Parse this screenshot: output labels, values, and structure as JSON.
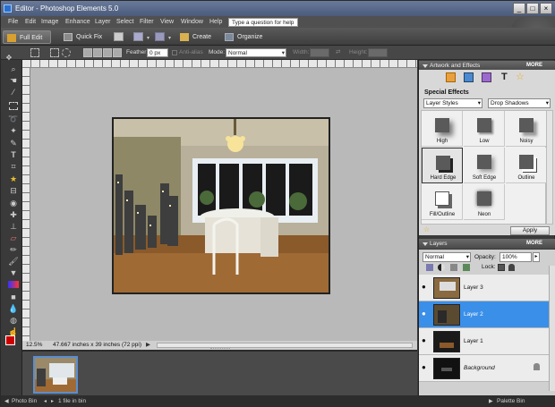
{
  "window": {
    "title": "Editor - Photoshop Elements 5.0"
  },
  "menu": {
    "items": [
      "File",
      "Edit",
      "Image",
      "Enhance",
      "Layer",
      "Select",
      "Filter",
      "View",
      "Window",
      "Help"
    ],
    "help_placeholder": "Type a question for help"
  },
  "modebar": {
    "full_edit": "Full Edit",
    "quick_fix": "Quick Fix",
    "create": "Create",
    "organize": "Organize"
  },
  "options": {
    "feather_label": "Feather:",
    "feather_value": "0 px",
    "anti_alias": "Anti-alias",
    "mode_label": "Mode:",
    "mode_value": "Normal",
    "width_label": "Width:",
    "height_label": "Height:"
  },
  "status": {
    "zoom": "12.5%",
    "doc_size": "47.667 inches x 39 inches (72 ppi)"
  },
  "bottom": {
    "photo_bin": "Photo Bin",
    "file_count": "1 file in bin",
    "palette_bin": "Palette Bin"
  },
  "artwork": {
    "title": "Artwork and Effects",
    "more": "MORE",
    "section": "Special Effects",
    "category": "Layer Styles",
    "style": "Drop Shadows",
    "swatches": [
      "High",
      "Low",
      "Noisy",
      "Hard Edge",
      "Soft Edge",
      "Outline",
      "Fill/Outline",
      "Neon"
    ],
    "apply": "Apply"
  },
  "layers": {
    "title": "Layers",
    "more": "MORE",
    "blend": "Normal",
    "opacity_label": "Opacity:",
    "opacity_value": "100%",
    "lock_label": "Lock:",
    "rows": [
      "Layer 3",
      "Layer 2",
      "Layer 1",
      "Background"
    ]
  },
  "colors": {
    "accent": "#3a8fe8",
    "foreground": "#cc0000",
    "background": "#ffffff"
  }
}
